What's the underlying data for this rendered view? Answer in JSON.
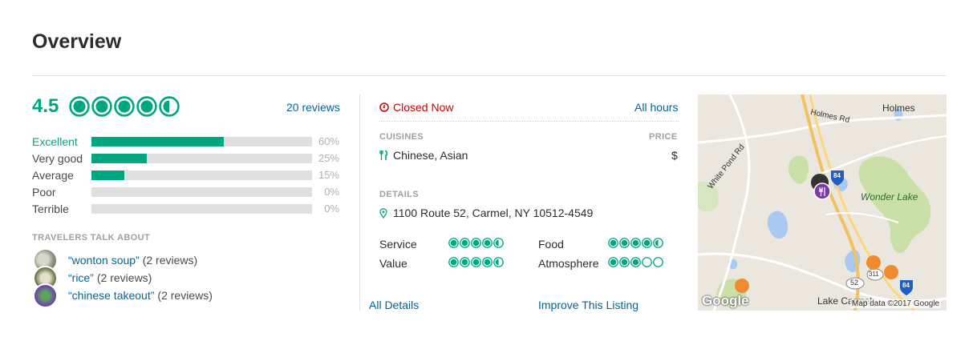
{
  "overview": {
    "title": "Overview"
  },
  "rating": {
    "score": "4.5",
    "bubbles": 4.5,
    "reviews_link": "20 reviews",
    "accent_color": "#00a680",
    "breakdown": [
      {
        "label": "Excellent",
        "pct": "60%",
        "value": 0.6
      },
      {
        "label": "Very good",
        "pct": "25%",
        "value": 0.25
      },
      {
        "label": "Average",
        "pct": "15%",
        "value": 0.15
      },
      {
        "label": "Poor",
        "pct": "0%",
        "value": 0
      },
      {
        "label": "Terrible",
        "pct": "0%",
        "value": 0
      }
    ]
  },
  "travelers": {
    "heading": "TRAVELERS TALK ABOUT",
    "items": [
      {
        "text": "“wonton soup”",
        "count": "(2 reviews)"
      },
      {
        "text": "“rice”",
        "count": "(2 reviews)"
      },
      {
        "text": "“chinese takeout”",
        "count": "(2 reviews)"
      }
    ]
  },
  "hours": {
    "status": "Closed Now",
    "status_icon": "clock-icon",
    "all_hours": "All hours"
  },
  "cuisines": {
    "heading": "CUISINES",
    "value": "Chinese, Asian",
    "icon": "fork-knife-icon"
  },
  "price": {
    "heading": "PRICE",
    "value": "$"
  },
  "details": {
    "heading": "DETAILS",
    "address": "1100 Route 52, Carmel, NY 10512-4549",
    "icon": "map-pin-icon"
  },
  "subratings": [
    {
      "label": "Service",
      "bubbles": 4.5
    },
    {
      "label": "Food",
      "bubbles": 4.5
    },
    {
      "label": "Value",
      "bubbles": 4.5
    },
    {
      "label": "Atmosphere",
      "bubbles": 3.0
    }
  ],
  "links": {
    "all_details": "All Details",
    "improve": "Improve This Listing"
  },
  "map": {
    "labels": {
      "holmes": "Holmes",
      "holmes_rd": "Holmes Rd",
      "white_pond_rd": "White Pond Rd",
      "wonder_lake": "Wonder Lake",
      "lake_carmel": "Lake Carmel",
      "route_84_top": "84",
      "route_84_bottom": "84",
      "route_52": "52",
      "route_311": "311",
      "google": "Google",
      "attribution": "Map data ©2017 Google"
    }
  }
}
